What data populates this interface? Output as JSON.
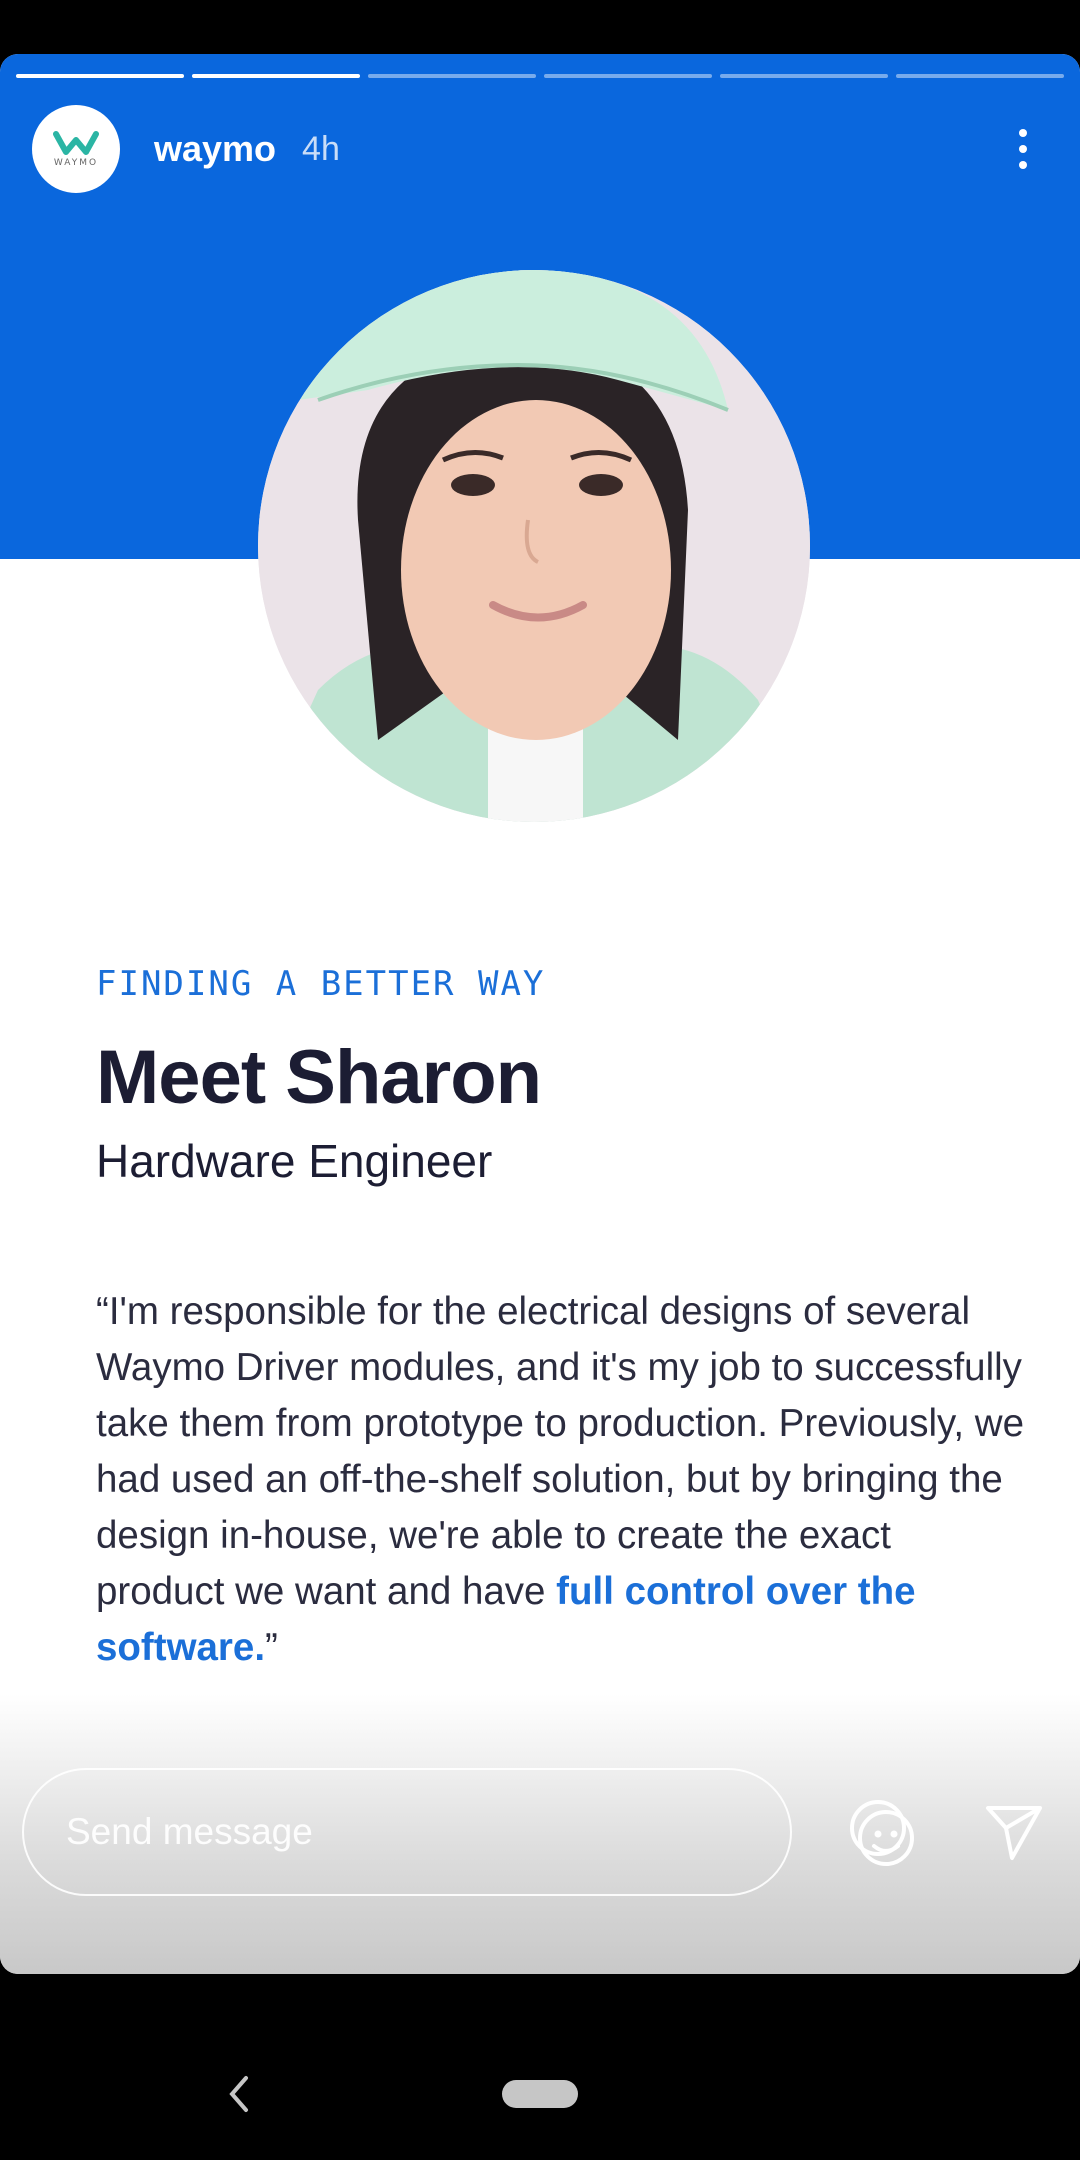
{
  "story": {
    "segments": 6,
    "completed_segments": 2,
    "account": {
      "username": "waymo",
      "time_ago": "4h",
      "logo_text": "WAYMO"
    },
    "colors": {
      "band": "#0a67dd",
      "accent": "#1b6fd8",
      "heading": "#1c1d33"
    },
    "content": {
      "eyebrow": "FINDING A BETTER WAY",
      "title": "Meet Sharon",
      "role": "Hardware Engineer",
      "quote_main": "“I'm responsible for the electrical designs of several Waymo Driver modules, and it's my job to successfully take them from prototype to production. Previously, we had used an off-the-shelf solution, but by bringing the design in-house, we're able to create the exact product we want and have ",
      "quote_highlight": "full control over the software.",
      "quote_end": "”"
    }
  },
  "reply": {
    "placeholder": "Send message",
    "icons": {
      "emoji": "emoji-reaction-icon",
      "send": "send-icon",
      "more": "more-vertical-icon"
    }
  },
  "system_nav": {
    "icons": {
      "back": "back-chevron-icon",
      "home": "home-pill-icon"
    }
  }
}
